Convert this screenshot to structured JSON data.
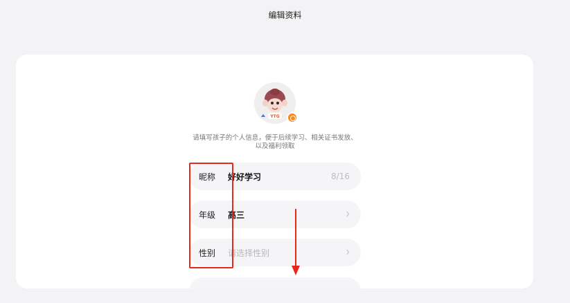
{
  "header": {
    "title": "编辑资料"
  },
  "avatar": {
    "badge_text": "YTG"
  },
  "hint": {
    "line1": "请填写孩子的个人信息，便于后续学习、相关证书发放、",
    "line2": "以及福利领取"
  },
  "fields": [
    {
      "label": "昵称",
      "value": "好好学习",
      "counter": "8/16"
    },
    {
      "label": "年级",
      "value": "高三",
      "chevron": "›"
    },
    {
      "label": "性别",
      "placeholder": "请选择性别",
      "chevron": "›"
    }
  ],
  "colors": {
    "accent": "#f7891d",
    "annotation": "#e8261c",
    "background": "#f3f3f5"
  },
  "icons": [
    "avatar-monkey-icon",
    "camera-icon",
    "chevron-right-icon"
  ]
}
